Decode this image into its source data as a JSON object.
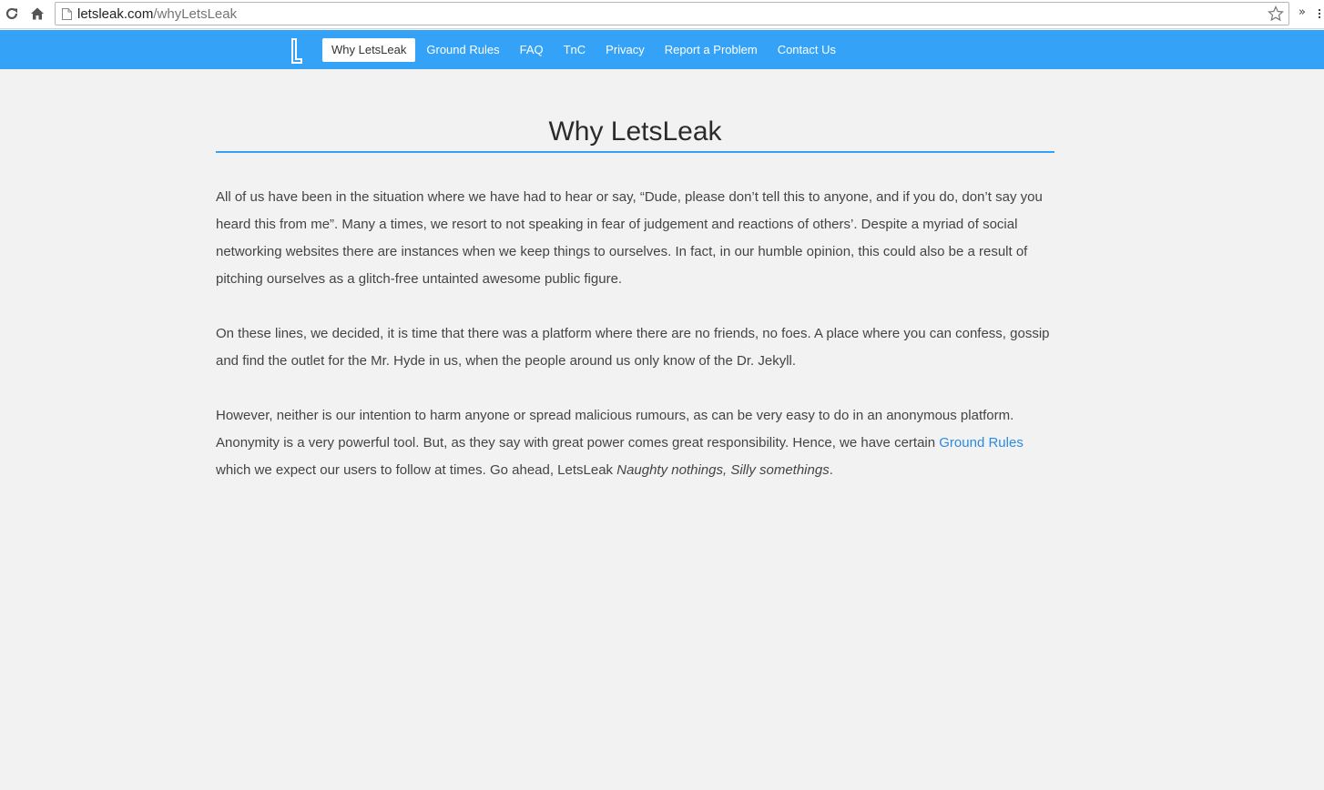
{
  "browser": {
    "url_domain": "letsleak.com",
    "url_path": "/whyLetsLeak",
    "overflow_label": "»"
  },
  "navbar": {
    "items": [
      {
        "label": "Why LetsLeak",
        "active": true
      },
      {
        "label": "Ground Rules",
        "active": false
      },
      {
        "label": "FAQ",
        "active": false
      },
      {
        "label": "TnC",
        "active": false
      },
      {
        "label": "Privacy",
        "active": false
      },
      {
        "label": "Report a Problem",
        "active": false
      },
      {
        "label": "Contact Us",
        "active": false
      }
    ],
    "color": "#34a3f7"
  },
  "main": {
    "title": "Why LetsLeak",
    "paragraph1": "All of us have been in the situation where we have had to hear or say, “Dude, please don’t tell this to anyone, and if you do, don’t say you heard this from me”. Many a times, we resort to not speaking in fear of judgement and reactions of others’. Despite a myriad of social networking websites there are instances when we keep things to ourselves. In fact, in our humble opinion, this could also be a result of pitching ourselves as a glitch-free untainted awesome public figure.",
    "paragraph2": "On these lines, we decided, it is time that there was a platform where there are no friends, no foes. A place where you can confess, gossip and find the outlet for the Mr. Hyde in us, when the people around us only know of the Dr. Jekyll.",
    "paragraph3_part1": "However, neither is our intention to harm anyone or spread malicious rumours, as can be very easy to do in an anonymous platform. Anonymity is a very powerful tool. But, as they say with great power comes great responsibility. Hence, we have certain ",
    "paragraph3_link": "Ground Rules",
    "paragraph3_part2": " which we expect our users to follow at times. Go ahead, LetsLeak ",
    "paragraph3_tagline": "Naughty nothings, Silly somethings",
    "paragraph3_end": ".",
    "link_color": "#2a8ae0"
  }
}
